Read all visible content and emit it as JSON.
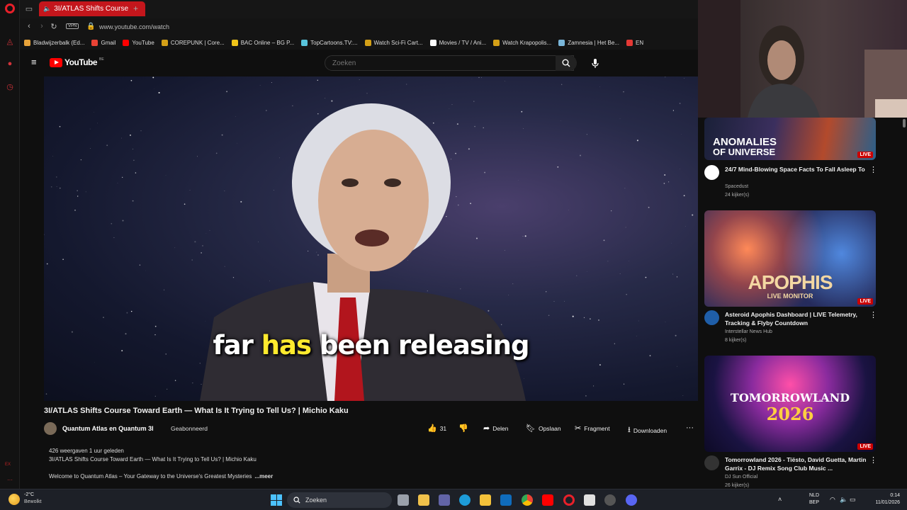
{
  "browser": {
    "tab": {
      "title": "3I/ATLAS Shifts Course"
    },
    "url": "www.youtube.com/watch",
    "vpn_label": "VPN",
    "bookmarks": [
      {
        "label": "Bladwijzerbalk (Ed...",
        "color": "#e8a33a"
      },
      {
        "label": "Gmail",
        "color": "#ea4335"
      },
      {
        "label": "YouTube",
        "color": "#ff0000"
      },
      {
        "label": "COREPUNK | Core...",
        "color": "#d4a017"
      },
      {
        "label": "BAC Online – BG P...",
        "color": "#f0c419"
      },
      {
        "label": "TopCartoons.TV:...",
        "color": "#58c4dc"
      },
      {
        "label": "Watch Sci-Fi Cart...",
        "color": "#d4a017"
      },
      {
        "label": "Movies / TV / Ani...",
        "color": "#ffffff"
      },
      {
        "label": "Watch Krapopolis...",
        "color": "#d4a017"
      },
      {
        "label": "Zamnesia | Het Be...",
        "color": "#7ab6d9"
      },
      {
        "label": "EN",
        "color": "#e53935"
      }
    ],
    "sidebar_text": "EX"
  },
  "youtube": {
    "logo_text": "YouTube",
    "region": "BE",
    "search_placeholder": "Zoeken",
    "caption": {
      "pre": "far ",
      "highlight": "has",
      "post": " been releasing"
    },
    "video_title": "3I/ATLAS Shifts Course Toward Earth — What Is It Trying to Tell Us? | Michio Kaku",
    "channel": "Quantum Atlas en Quantum 3I",
    "subscribe_label": "Geabonneerd",
    "likes": "31",
    "share_label": "Delen",
    "save_label": "Opslaan",
    "clip_label": "Fragment",
    "download_label": "Downloaden",
    "stats": "426 weergaven  1 uur geleden",
    "desc_line1": "3I/ATLAS Shifts Course Toward Earth — What Is It Trying to Tell Us? | Michio Kaku",
    "desc_line2": "Welcome to Quantum Atlas – Your Gateway to the Universe's Greatest Mysteries",
    "more_label": "...meer"
  },
  "recommendations": [
    {
      "thumb_text1": "ANOMALIES",
      "thumb_text2": "OF UNIVERSE",
      "live": "LIVE",
      "title": "24/7 Mind-Blowing Space Facts To Fall Asleep To",
      "channel": "Spacedust",
      "views": "24 kijker(s)"
    },
    {
      "thumb_text1": "APOPHIS",
      "thumb_text2": "LIVE MONITOR",
      "live": "LIVE",
      "title": "Asteroid Apophis Dashboard | LIVE Telemetry, Tracking & Flyby Countdown",
      "channel": "Interstellar News Hub",
      "views": "8 kijker(s)"
    },
    {
      "thumb_text1": "TOMORROWLAND",
      "thumb_text2": "2026",
      "live": "LIVE",
      "title": "Tomorrowland 2026 - Tiësto, David Guetta, Martin Garrix - DJ Remix Song Club Music ...",
      "channel": "DJ Sun Official",
      "views": "26 kijker(s)"
    }
  ],
  "taskbar": {
    "temp": "-2°C",
    "weather": "Bewolkt",
    "search_label": "Zoeken",
    "lang1": "NLD",
    "lang2": "BEP",
    "time": "0:14",
    "date": "11/01/2026"
  }
}
